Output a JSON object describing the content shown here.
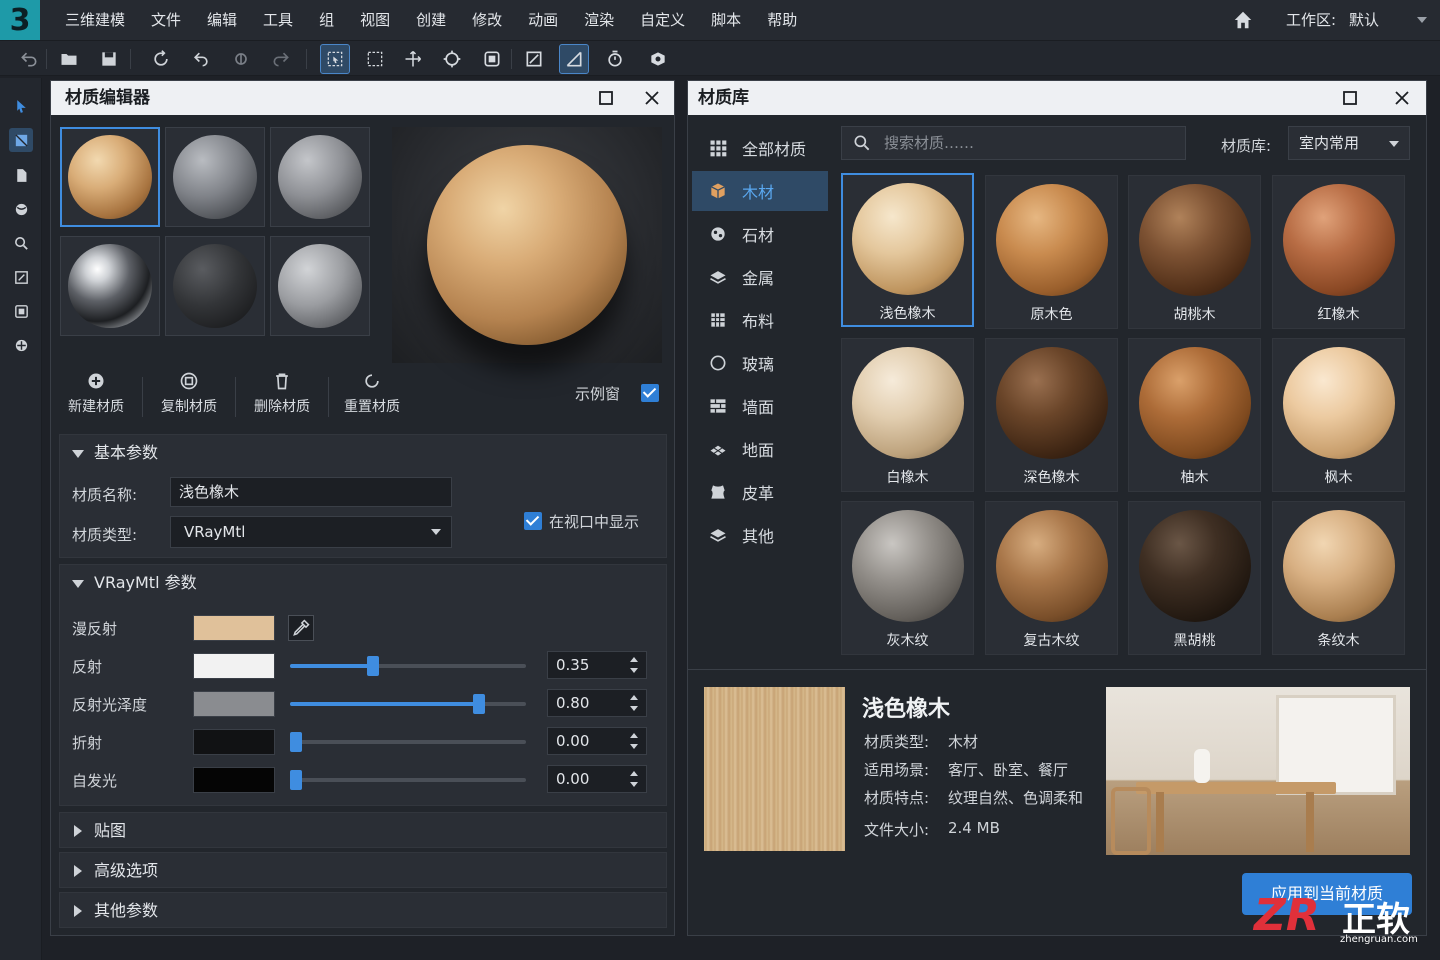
{
  "app": {
    "logo": "3",
    "menu": [
      "三维建模",
      "文件",
      "编辑",
      "工具",
      "组",
      "视图",
      "创建",
      "修改",
      "动画",
      "渲染",
      "自定义",
      "脚本",
      "帮助"
    ],
    "workspace_label": "工作区:",
    "workspace_value": "默认"
  },
  "editor": {
    "title": "材质编辑器",
    "actions": [
      {
        "label": "新建材质",
        "icon": "plus-circle-icon"
      },
      {
        "label": "复制材质",
        "icon": "copy-icon"
      },
      {
        "label": "删除材质",
        "icon": "trash-icon"
      },
      {
        "label": "重置材质",
        "icon": "reset-icon"
      }
    ],
    "sample_window_label": "示例窗",
    "basic": {
      "header": "基本参数",
      "name_label": "材质名称:",
      "name_value": "浅色橡木",
      "type_label": "材质类型:",
      "type_value": "VRayMtl",
      "show_in_viewport": "在视口中显示"
    },
    "vray": {
      "header": "VRayMtl 参数",
      "rows": [
        {
          "label": "漫反射",
          "color": "#e0c19a"
        },
        {
          "label": "反射",
          "color": "#f2f2f2",
          "value": "0.35",
          "level": 0.35
        },
        {
          "label": "反射光泽度",
          "color": "#8a8c90",
          "value": "0.80",
          "level": 0.8
        },
        {
          "label": "折射",
          "color": "#111214",
          "value": "0.00",
          "level": 0.0
        },
        {
          "label": "自发光",
          "color": "#050505",
          "value": "0.00",
          "level": 0.0
        }
      ]
    },
    "collapsed": [
      "贴图",
      "高级选项",
      "其他参数"
    ]
  },
  "library": {
    "title": "材质库",
    "search_placeholder": "搜索材质……",
    "lib_label": "材质库:",
    "lib_value": "室内常用",
    "categories": [
      "全部材质",
      "木材",
      "石材",
      "金属",
      "布料",
      "玻璃",
      "墙面",
      "地面",
      "皮革",
      "其他"
    ],
    "active_category": "木材",
    "materials": [
      "浅色橡木",
      "原木色",
      "胡桃木",
      "红橡木",
      "白橡木",
      "深色橡木",
      "柚木",
      "枫木",
      "灰木纹",
      "复古木纹",
      "黑胡桃",
      "条纹木"
    ],
    "detail": {
      "name": "浅色橡木",
      "rows": [
        {
          "label": "材质类型:",
          "value": "木材"
        },
        {
          "label": "适用场景:",
          "value": "客厅、卧室、餐厅"
        },
        {
          "label": "材质特点:",
          "value": "纹理自然、色调柔和"
        },
        {
          "label": "文件大小:",
          "value": "2.4 MB"
        }
      ]
    },
    "apply_button": "应用到当前材质"
  },
  "watermark": {
    "logo": "ZR",
    "brand": "正软",
    "url": "zhengruan.com"
  },
  "colors": {
    "accent": "#3f8de0",
    "panel": "#22262c",
    "title_bar": "#eef0f3"
  }
}
